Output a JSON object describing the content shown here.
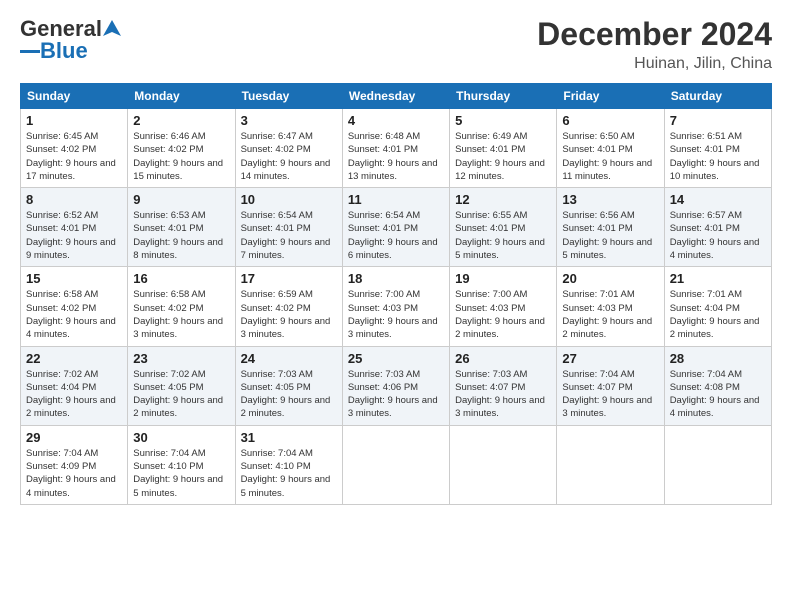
{
  "header": {
    "logo_general": "General",
    "logo_blue": "Blue",
    "main_title": "December 2024",
    "subtitle": "Huinan, Jilin, China"
  },
  "weekdays": [
    "Sunday",
    "Monday",
    "Tuesday",
    "Wednesday",
    "Thursday",
    "Friday",
    "Saturday"
  ],
  "weeks": [
    [
      {
        "day": "1",
        "sunrise": "6:45 AM",
        "sunset": "4:02 PM",
        "daylight": "9 hours and 17 minutes."
      },
      {
        "day": "2",
        "sunrise": "6:46 AM",
        "sunset": "4:02 PM",
        "daylight": "9 hours and 15 minutes."
      },
      {
        "day": "3",
        "sunrise": "6:47 AM",
        "sunset": "4:02 PM",
        "daylight": "9 hours and 14 minutes."
      },
      {
        "day": "4",
        "sunrise": "6:48 AM",
        "sunset": "4:01 PM",
        "daylight": "9 hours and 13 minutes."
      },
      {
        "day": "5",
        "sunrise": "6:49 AM",
        "sunset": "4:01 PM",
        "daylight": "9 hours and 12 minutes."
      },
      {
        "day": "6",
        "sunrise": "6:50 AM",
        "sunset": "4:01 PM",
        "daylight": "9 hours and 11 minutes."
      },
      {
        "day": "7",
        "sunrise": "6:51 AM",
        "sunset": "4:01 PM",
        "daylight": "9 hours and 10 minutes."
      }
    ],
    [
      {
        "day": "8",
        "sunrise": "6:52 AM",
        "sunset": "4:01 PM",
        "daylight": "9 hours and 9 minutes."
      },
      {
        "day": "9",
        "sunrise": "6:53 AM",
        "sunset": "4:01 PM",
        "daylight": "9 hours and 8 minutes."
      },
      {
        "day": "10",
        "sunrise": "6:54 AM",
        "sunset": "4:01 PM",
        "daylight": "9 hours and 7 minutes."
      },
      {
        "day": "11",
        "sunrise": "6:54 AM",
        "sunset": "4:01 PM",
        "daylight": "9 hours and 6 minutes."
      },
      {
        "day": "12",
        "sunrise": "6:55 AM",
        "sunset": "4:01 PM",
        "daylight": "9 hours and 5 minutes."
      },
      {
        "day": "13",
        "sunrise": "6:56 AM",
        "sunset": "4:01 PM",
        "daylight": "9 hours and 5 minutes."
      },
      {
        "day": "14",
        "sunrise": "6:57 AM",
        "sunset": "4:01 PM",
        "daylight": "9 hours and 4 minutes."
      }
    ],
    [
      {
        "day": "15",
        "sunrise": "6:58 AM",
        "sunset": "4:02 PM",
        "daylight": "9 hours and 4 minutes."
      },
      {
        "day": "16",
        "sunrise": "6:58 AM",
        "sunset": "4:02 PM",
        "daylight": "9 hours and 3 minutes."
      },
      {
        "day": "17",
        "sunrise": "6:59 AM",
        "sunset": "4:02 PM",
        "daylight": "9 hours and 3 minutes."
      },
      {
        "day": "18",
        "sunrise": "7:00 AM",
        "sunset": "4:03 PM",
        "daylight": "9 hours and 3 minutes."
      },
      {
        "day": "19",
        "sunrise": "7:00 AM",
        "sunset": "4:03 PM",
        "daylight": "9 hours and 2 minutes."
      },
      {
        "day": "20",
        "sunrise": "7:01 AM",
        "sunset": "4:03 PM",
        "daylight": "9 hours and 2 minutes."
      },
      {
        "day": "21",
        "sunrise": "7:01 AM",
        "sunset": "4:04 PM",
        "daylight": "9 hours and 2 minutes."
      }
    ],
    [
      {
        "day": "22",
        "sunrise": "7:02 AM",
        "sunset": "4:04 PM",
        "daylight": "9 hours and 2 minutes."
      },
      {
        "day": "23",
        "sunrise": "7:02 AM",
        "sunset": "4:05 PM",
        "daylight": "9 hours and 2 minutes."
      },
      {
        "day": "24",
        "sunrise": "7:03 AM",
        "sunset": "4:05 PM",
        "daylight": "9 hours and 2 minutes."
      },
      {
        "day": "25",
        "sunrise": "7:03 AM",
        "sunset": "4:06 PM",
        "daylight": "9 hours and 3 minutes."
      },
      {
        "day": "26",
        "sunrise": "7:03 AM",
        "sunset": "4:07 PM",
        "daylight": "9 hours and 3 minutes."
      },
      {
        "day": "27",
        "sunrise": "7:04 AM",
        "sunset": "4:07 PM",
        "daylight": "9 hours and 3 minutes."
      },
      {
        "day": "28",
        "sunrise": "7:04 AM",
        "sunset": "4:08 PM",
        "daylight": "9 hours and 4 minutes."
      }
    ],
    [
      {
        "day": "29",
        "sunrise": "7:04 AM",
        "sunset": "4:09 PM",
        "daylight": "9 hours and 4 minutes."
      },
      {
        "day": "30",
        "sunrise": "7:04 AM",
        "sunset": "4:10 PM",
        "daylight": "9 hours and 5 minutes."
      },
      {
        "day": "31",
        "sunrise": "7:04 AM",
        "sunset": "4:10 PM",
        "daylight": "9 hours and 5 minutes."
      },
      null,
      null,
      null,
      null
    ]
  ]
}
